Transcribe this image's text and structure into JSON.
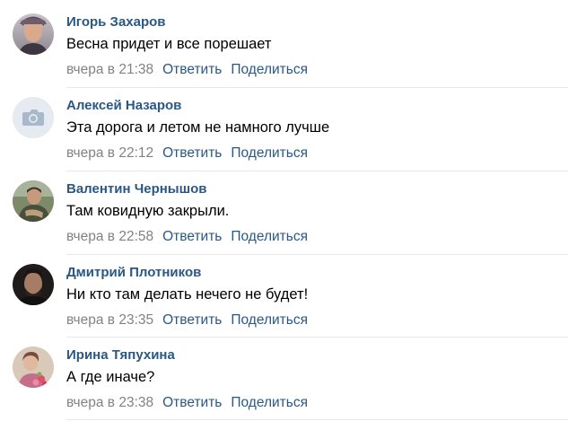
{
  "comments": [
    {
      "author": "Игорь Захаров",
      "text": "Весна придет и все порешает",
      "date": "вчера в 21:38",
      "avatar_icon": "photo-avatar-man"
    },
    {
      "author": "Алексей Назаров",
      "text": "Эта дорога и летом не намного лучше",
      "date": "вчера в 22:12",
      "avatar_icon": "camera-placeholder-icon"
    },
    {
      "author": "Валентин Чернышов",
      "text": "Там ковидную закрыли.",
      "date": "вчера в 22:58",
      "avatar_icon": "photo-avatar-man-outdoor"
    },
    {
      "author": "Дмитрий Плотников",
      "text": "Ни кто там делать нечего не будет!",
      "date": "вчера в 23:35",
      "avatar_icon": "photo-avatar-man-dark"
    },
    {
      "author": "Ирина Тяпухина",
      "text": "А где иначе?",
      "date": "вчера в 23:38",
      "avatar_icon": "photo-avatar-woman-flowers"
    }
  ],
  "actions": {
    "reply_label": "Ответить",
    "share_label": "Поделиться"
  },
  "colors": {
    "author_link": "#2a5885",
    "meta_gray": "#828282",
    "divider": "#e7e8ec",
    "placeholder_bg": "#e5ebf1",
    "placeholder_icon": "#a8b9cc"
  }
}
